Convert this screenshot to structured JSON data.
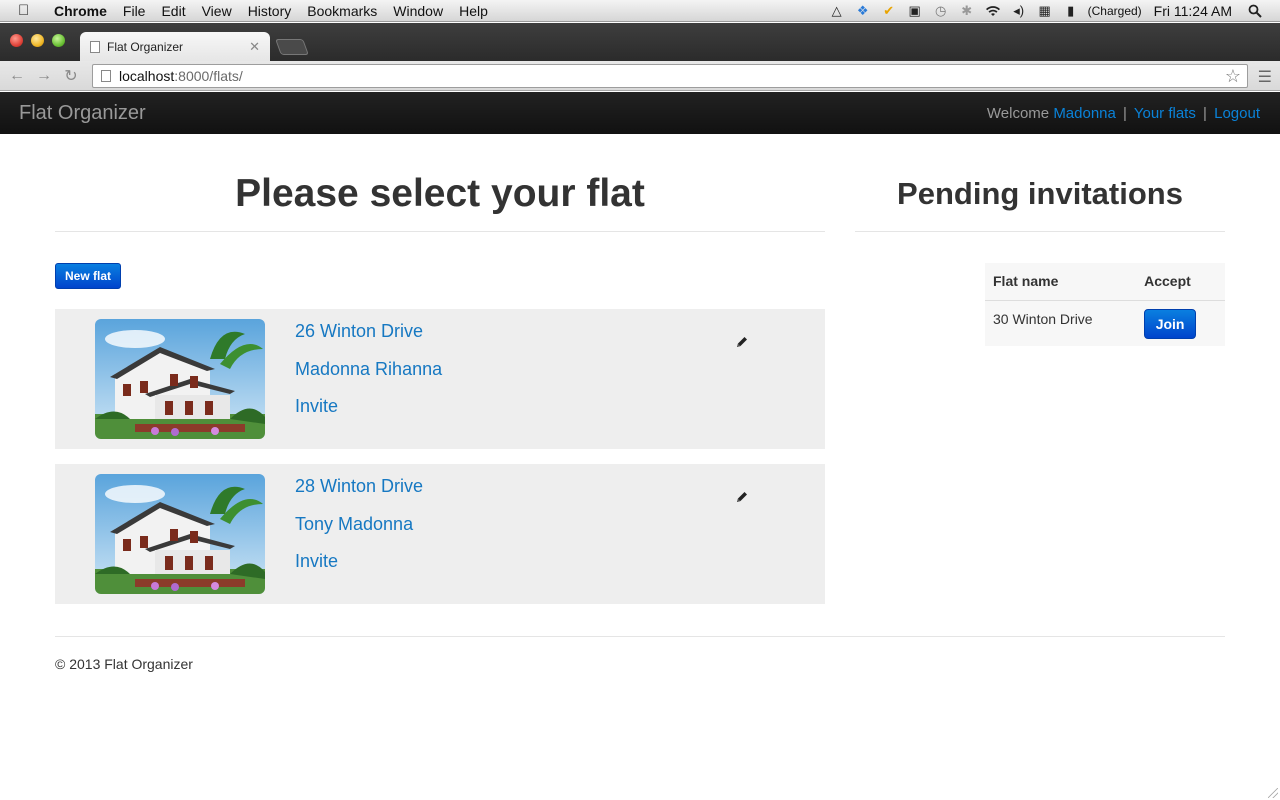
{
  "os_menubar": {
    "app_name": "Chrome",
    "menus": [
      "File",
      "Edit",
      "View",
      "History",
      "Bookmarks",
      "Window",
      "Help"
    ],
    "battery_status": "(Charged)",
    "clock": "Fri 11:24 AM"
  },
  "browser": {
    "tab_title": "Flat Organizer",
    "url_host": "localhost",
    "url_path": ":8000/flats/"
  },
  "navbar": {
    "brand": "Flat Organizer",
    "welcome": "Welcome",
    "user": "Madonna",
    "your_flats": "Your flats",
    "logout": "Logout",
    "separator": "|"
  },
  "main": {
    "title": "Please select your flat",
    "new_flat_label": "New flat",
    "flats": [
      {
        "name": "26 Winton Drive",
        "members": "Madonna Rihanna",
        "invite": "Invite"
      },
      {
        "name": "28 Winton Drive",
        "members": "Tony Madonna",
        "invite": "Invite"
      }
    ]
  },
  "sidebar": {
    "title": "Pending invitations",
    "columns": [
      "Flat name",
      "Accept"
    ],
    "rows": [
      {
        "flat_name": "30 Winton Drive",
        "accept_label": "Join"
      }
    ]
  },
  "footer": {
    "copyright": "© 2013 Flat Organizer"
  },
  "colors": {
    "link": "#1678c2",
    "primary_button": "#0055d4",
    "navbar": "#1b1b1b",
    "card": "#eeeeee"
  }
}
